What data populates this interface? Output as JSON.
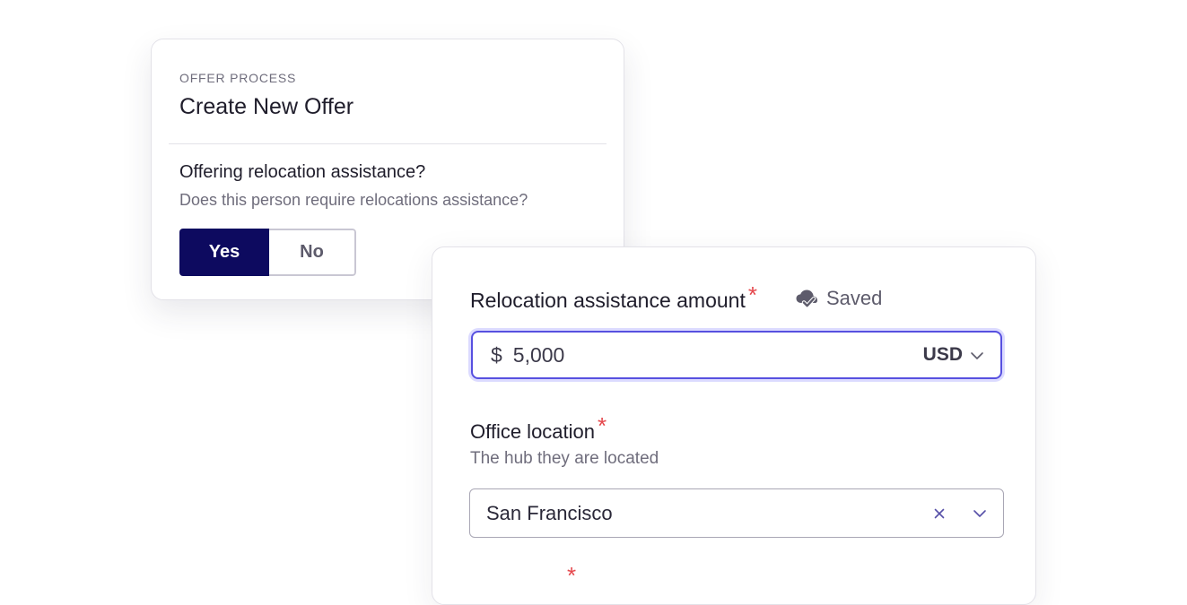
{
  "offer_card": {
    "eyebrow": "OFFER PROCESS",
    "title": "Create New Offer",
    "question": "Offering relocation assistance?",
    "question_help": "Does this person require relocations assistance?",
    "options": [
      "Yes",
      "No"
    ],
    "selected_option": "Yes"
  },
  "relocation_card": {
    "amount_label": "Relocation assistance amount",
    "required_mark": "*",
    "saved_label": "Saved",
    "saved_icon": "cloud-check-icon",
    "currency_symbol": "$",
    "amount_value": "5,000",
    "currency": "USD",
    "office_label": "Office location",
    "office_help": "The hub they are located",
    "office_value": "San Francisco"
  },
  "colors": {
    "primary_dark": "#0d0a5f",
    "focus_border": "#5750e0",
    "required": "#e5484d"
  }
}
